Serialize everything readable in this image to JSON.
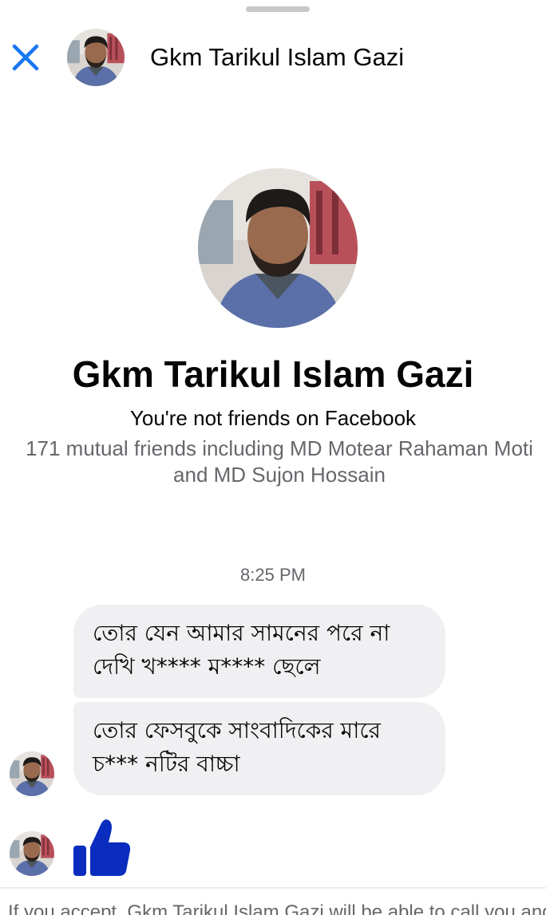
{
  "header": {
    "close_icon": "close-icon",
    "contact_name": "Gkm Tarikul Islam Gazi"
  },
  "profile": {
    "name": "Gkm Tarikul Islam Gazi",
    "friend_status": "You're not friends on Facebook",
    "mutual_friends": "171 mutual friends including MD Motear Rahaman Moti and MD Sujon Hossain"
  },
  "conversation": {
    "timestamp": "8:25 PM",
    "messages": [
      {
        "text": "তোর যেন আমার সামনের পরে না দেখি খ**** ম**** ছেলে"
      },
      {
        "text": "তোর ফেসবুকে সাংবাদিকের মারে চ*** নটির বাচ্চা"
      }
    ],
    "reaction_icon": "thumbs-up-icon"
  },
  "footer": {
    "request_notice": "If you accept, Gkm Tarikul Islam Gazi will be able to call you and"
  },
  "colors": {
    "accent_blue": "#1877f2",
    "like_blue": "#0a2dbf",
    "bubble_gray": "#f0f0f2",
    "secondary_text": "#65676b"
  }
}
